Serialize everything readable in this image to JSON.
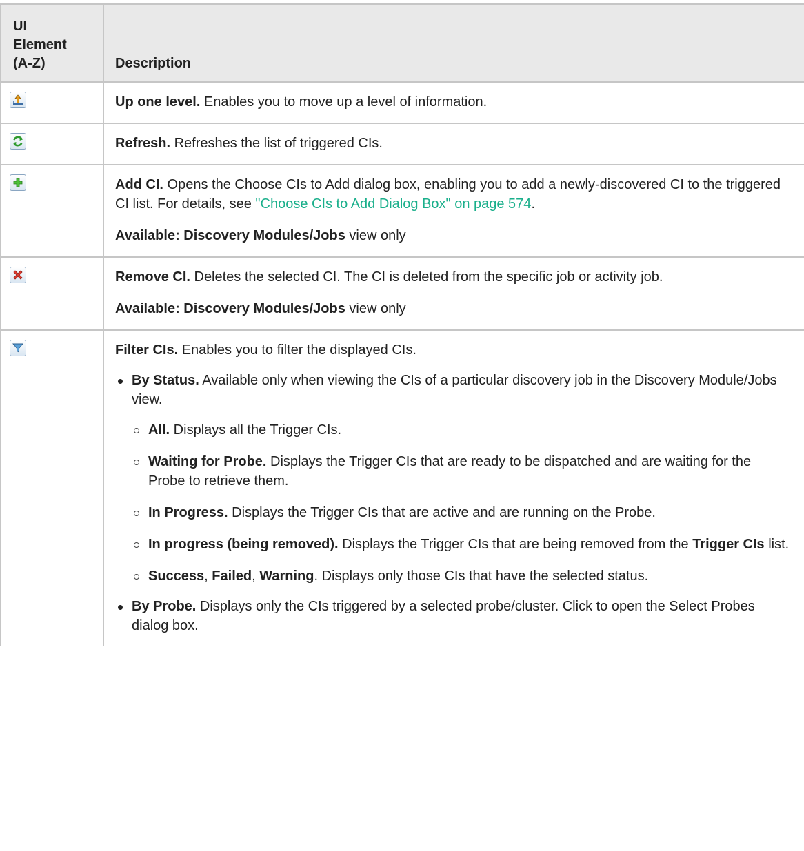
{
  "header": {
    "col1_line1": "UI",
    "col1_line2": "Element",
    "col1_line3": "(A-Z)",
    "col2": "Description"
  },
  "rows": [
    {
      "icon": "up-one-level-icon",
      "title": "Up one level.",
      "text": " Enables you to move up a level of information."
    },
    {
      "icon": "refresh-icon",
      "title": "Refresh.",
      "text": " Refreshes the list of triggered CIs."
    },
    {
      "icon": "add-ci-icon",
      "title": "Add CI.",
      "text": " Opens the Choose CIs to Add dialog box, enabling you to add a newly-discovered CI to the triggered CI list. For details, see ",
      "link": "\"Choose CIs to Add Dialog Box\" on page 574",
      "after_link": ".",
      "available_label": "Available: Discovery Modules/Jobs",
      "available_suffix": " view only"
    },
    {
      "icon": "remove-ci-icon",
      "title": "Remove CI.",
      "text": " Deletes the selected CI. The CI is deleted from the specific job or activity job.",
      "available_label": "Available: Discovery Modules/Jobs",
      "available_suffix": " view only"
    },
    {
      "icon": "filter-icon",
      "title": "Filter CIs.",
      "text": " Enables you to filter the displayed CIs.",
      "by_status": {
        "title": "By Status.",
        "text": " Available only when viewing the CIs of a particular discovery job in the Discovery Module/Jobs view.",
        "items": [
          {
            "title": "All.",
            "text": " Displays all the Trigger CIs."
          },
          {
            "title": "Waiting for Probe.",
            "text": " Displays the Trigger CIs that are ready to be dispatched and are waiting for the Probe to retrieve them."
          },
          {
            "title": "In Progress.",
            "text": " Displays the Trigger CIs that are active and are running on the Probe."
          },
          {
            "title": "In progress (being removed).",
            "text": " Displays the Trigger CIs that are being removed from the ",
            "bold2": "Trigger CIs",
            "text2": " list."
          },
          {
            "title": "Success",
            "sep1": ", ",
            "bold2": "Failed",
            "sep2": ", ",
            "bold3": "Warning",
            "text": ". Displays only those CIs that have the selected status."
          }
        ]
      },
      "by_probe": {
        "title": "By Probe.",
        "text": " Displays only the CIs triggered by a selected probe/cluster. Click to open the Select Probes dialog box."
      }
    }
  ],
  "colors": {
    "header_bg": "#e9e9e9",
    "border": "#c6c6c6",
    "link": "#1aaf8b",
    "text": "#222222"
  }
}
